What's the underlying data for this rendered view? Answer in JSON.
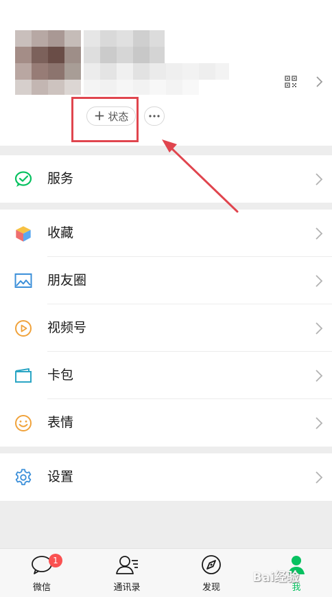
{
  "profile": {
    "status_label": "状态",
    "more_label": "···"
  },
  "menu": {
    "service": "服务",
    "favorites": "收藏",
    "moments": "朋友圈",
    "channels": "视频号",
    "cards": "卡包",
    "stickers": "表情",
    "settings": "设置"
  },
  "tabbar": {
    "chats": "微信",
    "chats_badge": "1",
    "contacts": "通讯录",
    "discover": "发现",
    "me": "我"
  },
  "watermark": "Bai经验",
  "colors": {
    "highlight": "#e0454e",
    "wechat_green": "#07c160",
    "badge": "#fa5151"
  }
}
